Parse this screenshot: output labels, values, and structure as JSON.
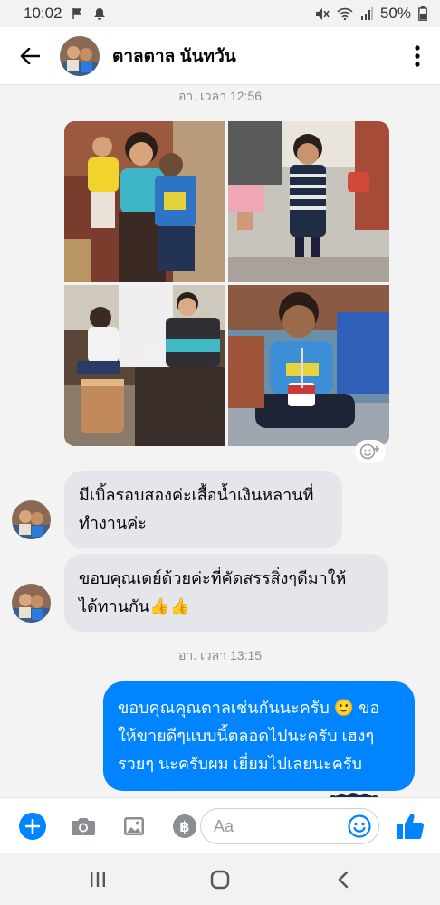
{
  "status_bar": {
    "time": "10:02",
    "battery_percent": "50%"
  },
  "header": {
    "contact_name": "ตาลตาล นันทวัน"
  },
  "chat": {
    "timestamp_1": "อา. เวลา 12:56",
    "timestamp_2": "อา. เวลา 13:15",
    "photos": [
      "photo-1",
      "photo-2",
      "photo-3",
      "photo-4"
    ],
    "messages": [
      {
        "side": "in",
        "line1": "มีเบิ้ลรอบสองค่ะเสื้อน้ำเงินหลานที่",
        "line2": "ทำงานค่ะ"
      },
      {
        "side": "in",
        "line1": "ขอบคุณเดย์ด้วยค่ะที่คัดสรรสิ่งๆดีมาให้",
        "line2": "ได้ทานกัน👍👍"
      },
      {
        "side": "out",
        "line1": "ขอบคุณคุณตาลเช่นกันนะครับ 🙂 ขอ",
        "line2": "ให้ขายดีๆแบบนี้ตลอดไปนะครับ เฮงๆ",
        "line3": "รวยๆ นะครับผม เยี่ยมไปเลยนะครับ"
      }
    ]
  },
  "composer": {
    "placeholder": "Aa"
  },
  "colors": {
    "accent": "#0084ff",
    "incoming_bubble": "#e4e6eb",
    "chat_background": "#f3f3f3"
  },
  "icons": [
    "back-arrow-icon",
    "more-vertical-icon",
    "plus-icon",
    "camera-icon",
    "gallery-icon",
    "baht-pay-icon",
    "emoji-icon",
    "thumbs-up-icon",
    "recent-apps-icon",
    "home-icon",
    "back-nav-icon"
  ]
}
